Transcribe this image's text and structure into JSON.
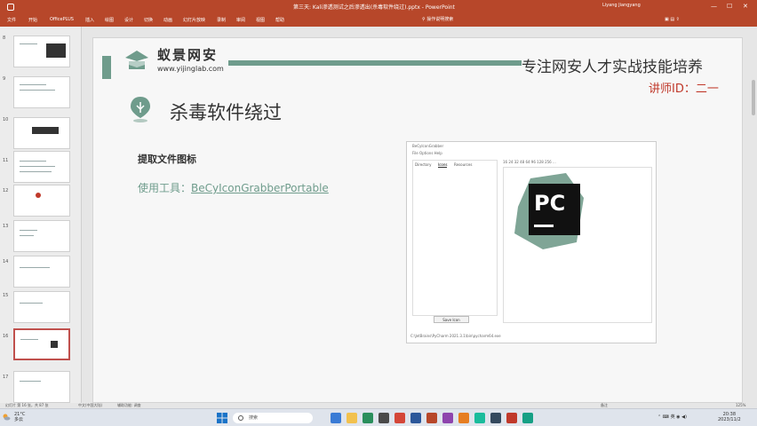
{
  "window": {
    "title": "第三天: Kali渗透测试之后渗透出(杀毒软件绕过).pptx - PowerPoint",
    "user": "Liyang Jiangyang"
  },
  "ribbon": {
    "tabs": [
      "文件",
      "开始",
      "OfficePLUS",
      "插入",
      "绘图",
      "设计",
      "切换",
      "动画",
      "幻灯片放映",
      "录制",
      "审阅",
      "视图",
      "帮助"
    ],
    "search_label": "操作说明搜索"
  },
  "thumbnails": {
    "numbers": [
      "8",
      "9",
      "10",
      "11",
      "12",
      "13",
      "14",
      "15",
      "16",
      "17",
      "18"
    ],
    "active_index": 8
  },
  "slide": {
    "brand_cn": "蚁景网安",
    "brand_url": "www.yijinglab.com",
    "slogan": "专注网安人才实战技能培养",
    "lecturer": "讲师ID：二一",
    "section_title": "杀毒软件绕过",
    "subhead": "提取文件图标",
    "tool_prefix": "使用工具：",
    "tool_name": "BeCyIconGrabberPortable"
  },
  "embedded_app": {
    "title": "BeCyIconGrabber",
    "menu": "File  Options  Help",
    "tabs": [
      "Directory",
      "Icons",
      "Resources"
    ],
    "sizes": "16  24  32  48  64  96  128  256  ...",
    "save_button": "Save Icon",
    "status": "C:\\JetBrains\\PyCharm 2021.3.1\\bin\\pycharm64.exe",
    "icon_letters": "PC"
  },
  "statusbar": {
    "slide_info": "幻灯片 第 16 张，共 87 张",
    "language": "中文(中国大陆)",
    "accessibility": "辅助功能: 调查",
    "notes": "备注",
    "zoom": "125%"
  },
  "taskbar": {
    "weather_temp": "21°C",
    "weather_desc": "多云",
    "search_placeholder": "搜索",
    "time": "20:38",
    "date": "2023/11/2"
  },
  "colors": {
    "accent": "#b7472a",
    "brand_green": "#6f9c8c",
    "lecturer_red": "#c0392b"
  }
}
